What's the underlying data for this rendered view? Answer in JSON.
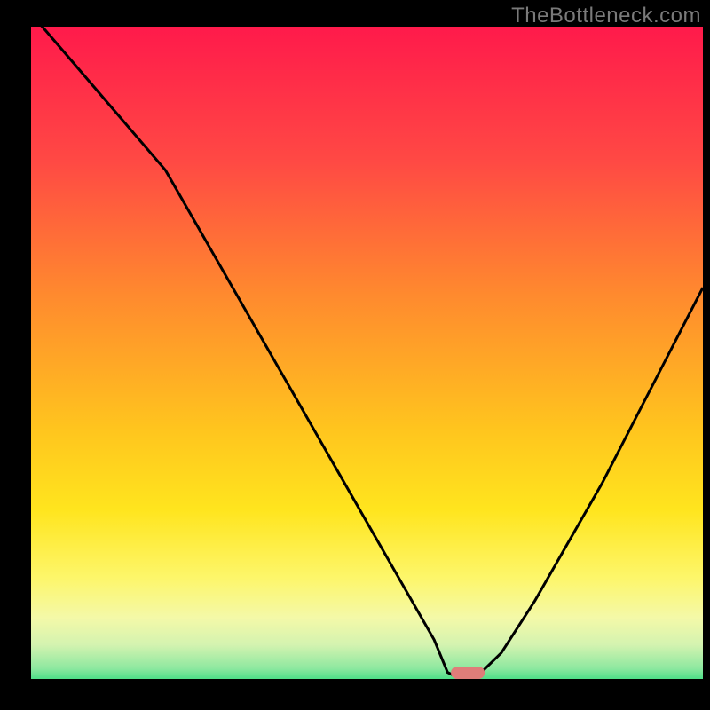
{
  "watermark": "TheBottleneck.com",
  "chart_data": {
    "type": "line",
    "title": "",
    "xlabel": "",
    "ylabel": "",
    "x": [
      0,
      5,
      10,
      15,
      20,
      25,
      30,
      35,
      40,
      45,
      50,
      55,
      60,
      62,
      64,
      66,
      70,
      75,
      80,
      85,
      90,
      95,
      100
    ],
    "values": [
      102,
      96,
      90,
      84,
      78,
      69,
      60,
      51,
      42,
      33,
      24,
      15,
      6,
      1,
      0,
      0,
      4,
      12,
      21,
      30,
      40,
      50,
      60
    ],
    "ylim": [
      0,
      100
    ],
    "xlim": [
      0,
      100
    ],
    "marker_x": 65,
    "marker_width_pct": 5,
    "legend": false,
    "grid": false,
    "gradient_stops": [
      {
        "pos": 0.0,
        "color": "#ff1a4b"
      },
      {
        "pos": 0.2,
        "color": "#ff4944"
      },
      {
        "pos": 0.4,
        "color": "#ff8a2e"
      },
      {
        "pos": 0.6,
        "color": "#ffc51e"
      },
      {
        "pos": 0.72,
        "color": "#ffe51e"
      },
      {
        "pos": 0.82,
        "color": "#fdf66a"
      },
      {
        "pos": 0.88,
        "color": "#f4f9a8"
      },
      {
        "pos": 0.92,
        "color": "#d4f3b0"
      },
      {
        "pos": 0.955,
        "color": "#8ee8a0"
      },
      {
        "pos": 0.975,
        "color": "#3edc82"
      },
      {
        "pos": 1.0,
        "color": "#17d36f"
      }
    ]
  }
}
